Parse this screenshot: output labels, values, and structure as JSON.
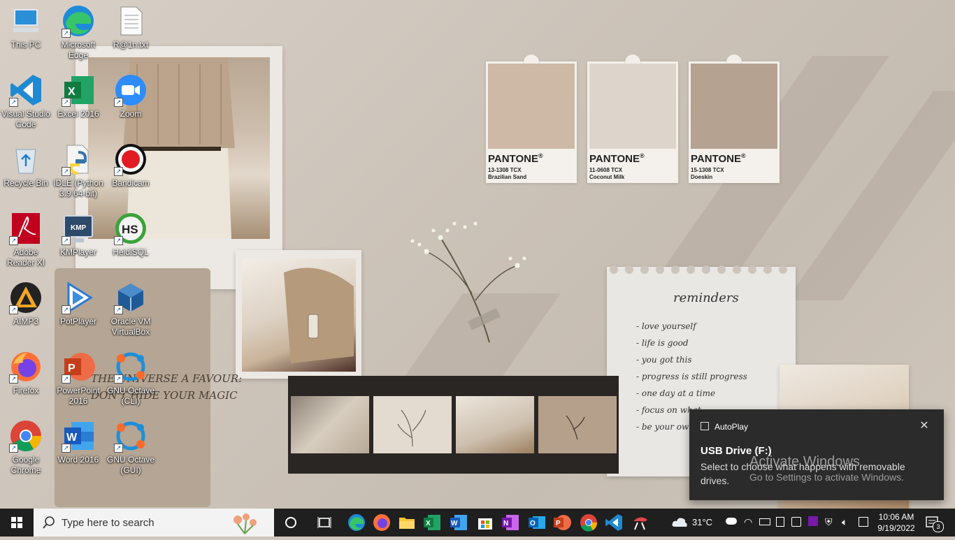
{
  "desktop_icons": [
    {
      "label": "This PC",
      "icon": "this-pc-icon"
    },
    {
      "label": "Microsoft Edge",
      "icon": "edge-icon"
    },
    {
      "label": "R@1n.txt",
      "icon": "text-file-icon"
    },
    {
      "label": "Visual Studio Code",
      "icon": "vscode-icon"
    },
    {
      "label": "Excel 2016",
      "icon": "excel-icon"
    },
    {
      "label": "Zoom",
      "icon": "zoom-icon"
    },
    {
      "label": "Recycle Bin",
      "icon": "recycle-bin-icon"
    },
    {
      "label": "IDLE (Python 3.9 64-bit)",
      "icon": "python-idle-icon"
    },
    {
      "label": "Bandicam",
      "icon": "bandicam-icon"
    },
    {
      "label": "Adobe Reader XI",
      "icon": "adobe-reader-icon"
    },
    {
      "label": "KMPlayer",
      "icon": "kmplayer-icon"
    },
    {
      "label": "HeidiSQL",
      "icon": "heidisql-icon"
    },
    {
      "label": "AIMP3",
      "icon": "aimp-icon"
    },
    {
      "label": "PotPlayer",
      "icon": "potplayer-icon"
    },
    {
      "label": "Oracle VM VirtualBox",
      "icon": "virtualbox-icon"
    },
    {
      "label": "Firefox",
      "icon": "firefox-icon"
    },
    {
      "label": "PowerPoint 2016",
      "icon": "powerpoint-icon"
    },
    {
      "label": "GNU Octave (CLI)",
      "icon": "octave-icon"
    },
    {
      "label": "Google Chrome",
      "icon": "chrome-icon"
    },
    {
      "label": "Word 2016",
      "icon": "word-icon"
    },
    {
      "label": "GNU Octave (GUI)",
      "icon": "octave-icon"
    }
  ],
  "wallpaper": {
    "pantone": [
      {
        "brand": "PANTONE",
        "code": "13-1308 TCX",
        "name": "Brazilian Sand",
        "color": "#cdb9a5"
      },
      {
        "brand": "PANTONE",
        "code": "11-0608 TCX",
        "name": "Coconut Milk",
        "color": "#ddd5cb"
      },
      {
        "brand": "PANTONE",
        "code": "15-1308 TCX",
        "name": "Doeskin",
        "color": "#b5a291"
      }
    ],
    "notes_title": "reminders",
    "notes": [
      "- love yourself",
      "- life is good",
      "- you got this",
      "- progress is still progress",
      "- one day at a time",
      "- focus on what...",
      "- be your own..."
    ],
    "panel_text_line1": "THE UNIVERSE A FAVOUR:",
    "panel_text_line2": "DON'T HIDE YOUR MAGIC"
  },
  "toast": {
    "app": "AutoPlay",
    "close_glyph": "✕",
    "title": "USB Drive (F:)",
    "body": "Select to choose what happens with removable drives."
  },
  "watermark": {
    "line1": "Activate Windows",
    "line2": "Go to Settings to activate Windows."
  },
  "taskbar": {
    "search_placeholder": "Type here to search",
    "pinned": [
      "cortana-icon",
      "task-view-icon",
      "edge-icon",
      "firefox-icon",
      "file-explorer-icon",
      "excel-icon",
      "word-icon",
      "store-icon",
      "onenote-icon",
      "outlook-icon",
      "powerpoint-icon",
      "chrome-icon",
      "vscode-icon",
      "snipping-icon"
    ],
    "weather": "31°C",
    "time": "10:06 AM",
    "date": "9/19/2022",
    "notification_count": "3"
  }
}
